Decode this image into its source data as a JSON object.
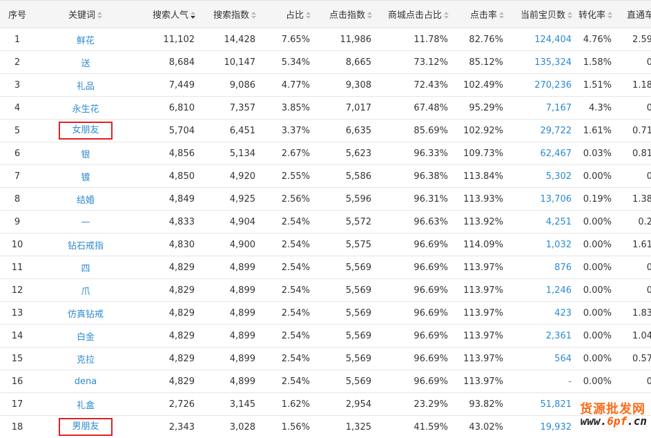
{
  "columns": [
    {
      "label": "序号",
      "sortable": false
    },
    {
      "label": "关键词",
      "sortable": true
    },
    {
      "label": "搜索人气",
      "sortable": true,
      "active": true
    },
    {
      "label": "搜索指数",
      "sortable": true
    },
    {
      "label": "占比",
      "sortable": true
    },
    {
      "label": "点击指数",
      "sortable": true
    },
    {
      "label": "商城点击占比",
      "sortable": true
    },
    {
      "label": "点击率",
      "sortable": true
    },
    {
      "label": "当前宝贝数",
      "sortable": true
    },
    {
      "label": "转化率",
      "sortable": true
    },
    {
      "label": "直通车",
      "sortable": false
    }
  ],
  "rows": [
    {
      "idx": "1",
      "kw": "鲜花",
      "pop": "11,102",
      "sidx": "14,428",
      "share": "7.65%",
      "cidx": "11,986",
      "mall": "11.78%",
      "ctr": "82.76%",
      "items": "124,404",
      "conv": "4.76%",
      "ztc": "2.59",
      "highlight": false
    },
    {
      "idx": "2",
      "kw": "送",
      "pop": "8,684",
      "sidx": "10,147",
      "share": "5.34%",
      "cidx": "8,665",
      "mall": "73.12%",
      "ctr": "85.12%",
      "items": "135,324",
      "conv": "1.58%",
      "ztc": "0",
      "highlight": false
    },
    {
      "idx": "3",
      "kw": "礼品",
      "pop": "7,449",
      "sidx": "9,086",
      "share": "4.77%",
      "cidx": "9,308",
      "mall": "72.43%",
      "ctr": "102.49%",
      "items": "270,236",
      "conv": "1.51%",
      "ztc": "1.18",
      "highlight": false
    },
    {
      "idx": "4",
      "kw": "永生花",
      "pop": "6,810",
      "sidx": "7,357",
      "share": "3.85%",
      "cidx": "7,017",
      "mall": "67.48%",
      "ctr": "95.29%",
      "items": "7,167",
      "conv": "4.3%",
      "ztc": "0",
      "highlight": false
    },
    {
      "idx": "5",
      "kw": "女朋友",
      "pop": "5,704",
      "sidx": "6,451",
      "share": "3.37%",
      "cidx": "6,635",
      "mall": "85.69%",
      "ctr": "102.92%",
      "items": "29,722",
      "conv": "1.61%",
      "ztc": "0.71",
      "highlight": true
    },
    {
      "idx": "6",
      "kw": "银",
      "pop": "4,856",
      "sidx": "5,134",
      "share": "2.67%",
      "cidx": "5,623",
      "mall": "96.33%",
      "ctr": "109.73%",
      "items": "62,467",
      "conv": "0.03%",
      "ztc": "0.81",
      "highlight": false
    },
    {
      "idx": "7",
      "kw": "镀",
      "pop": "4,850",
      "sidx": "4,920",
      "share": "2.55%",
      "cidx": "5,586",
      "mall": "96.38%",
      "ctr": "113.84%",
      "items": "5,302",
      "conv": "0.00%",
      "ztc": "0",
      "highlight": false
    },
    {
      "idx": "8",
      "kw": "结婚",
      "pop": "4,849",
      "sidx": "4,925",
      "share": "2.56%",
      "cidx": "5,596",
      "mall": "96.31%",
      "ctr": "113.93%",
      "items": "13,706",
      "conv": "0.19%",
      "ztc": "1.38",
      "highlight": false
    },
    {
      "idx": "9",
      "kw": "—",
      "pop": "4,833",
      "sidx": "4,904",
      "share": "2.54%",
      "cidx": "5,572",
      "mall": "96.63%",
      "ctr": "113.92%",
      "items": "4,251",
      "conv": "0.00%",
      "ztc": "0.2",
      "highlight": false
    },
    {
      "idx": "10",
      "kw": "钻石戒指",
      "pop": "4,830",
      "sidx": "4,900",
      "share": "2.54%",
      "cidx": "5,575",
      "mall": "96.69%",
      "ctr": "114.09%",
      "items": "1,032",
      "conv": "0.00%",
      "ztc": "1.61",
      "highlight": false
    },
    {
      "idx": "11",
      "kw": "四",
      "pop": "4,829",
      "sidx": "4,899",
      "share": "2.54%",
      "cidx": "5,569",
      "mall": "96.69%",
      "ctr": "113.97%",
      "items": "876",
      "conv": "0.00%",
      "ztc": "0",
      "highlight": false
    },
    {
      "idx": "12",
      "kw": "爪",
      "pop": "4,829",
      "sidx": "4,899",
      "share": "2.54%",
      "cidx": "5,569",
      "mall": "96.69%",
      "ctr": "113.97%",
      "items": "1,246",
      "conv": "0.00%",
      "ztc": "0",
      "highlight": false
    },
    {
      "idx": "13",
      "kw": "仿真钻戒",
      "pop": "4,829",
      "sidx": "4,899",
      "share": "2.54%",
      "cidx": "5,569",
      "mall": "96.69%",
      "ctr": "113.97%",
      "items": "423",
      "conv": "0.00%",
      "ztc": "1.83",
      "highlight": false
    },
    {
      "idx": "14",
      "kw": "白金",
      "pop": "4,829",
      "sidx": "4,899",
      "share": "2.54%",
      "cidx": "5,569",
      "mall": "96.69%",
      "ctr": "113.97%",
      "items": "2,361",
      "conv": "0.00%",
      "ztc": "1.04",
      "highlight": false
    },
    {
      "idx": "15",
      "kw": "克拉",
      "pop": "4,829",
      "sidx": "4,899",
      "share": "2.54%",
      "cidx": "5,569",
      "mall": "96.69%",
      "ctr": "113.97%",
      "items": "564",
      "conv": "0.00%",
      "ztc": "0.57",
      "highlight": false
    },
    {
      "idx": "16",
      "kw": "dena",
      "pop": "4,829",
      "sidx": "4,899",
      "share": "2.54%",
      "cidx": "5,569",
      "mall": "96.69%",
      "ctr": "113.97%",
      "items": "-",
      "conv": "0.00%",
      "ztc": "0",
      "highlight": false
    },
    {
      "idx": "17",
      "kw": "礼盒",
      "pop": "2,726",
      "sidx": "3,145",
      "share": "1.62%",
      "cidx": "2,954",
      "mall": "23.29%",
      "ctr": "93.82%",
      "items": "51,821",
      "conv": "",
      "ztc": "",
      "highlight": false
    },
    {
      "idx": "18",
      "kw": "男朋友",
      "pop": "2,343",
      "sidx": "3,028",
      "share": "1.56%",
      "cidx": "1,325",
      "mall": "41.59%",
      "ctr": "43.02%",
      "items": "19,932",
      "conv": "",
      "ztc": "",
      "highlight": true
    }
  ],
  "watermark": {
    "brand": "货源批发网",
    "site_prefix": "6pf",
    "site_suffix": ".cn"
  },
  "colors": {
    "link": "#2b8bd0",
    "highlight_box": "#e02020",
    "header_bg": "#f5f5f5"
  }
}
